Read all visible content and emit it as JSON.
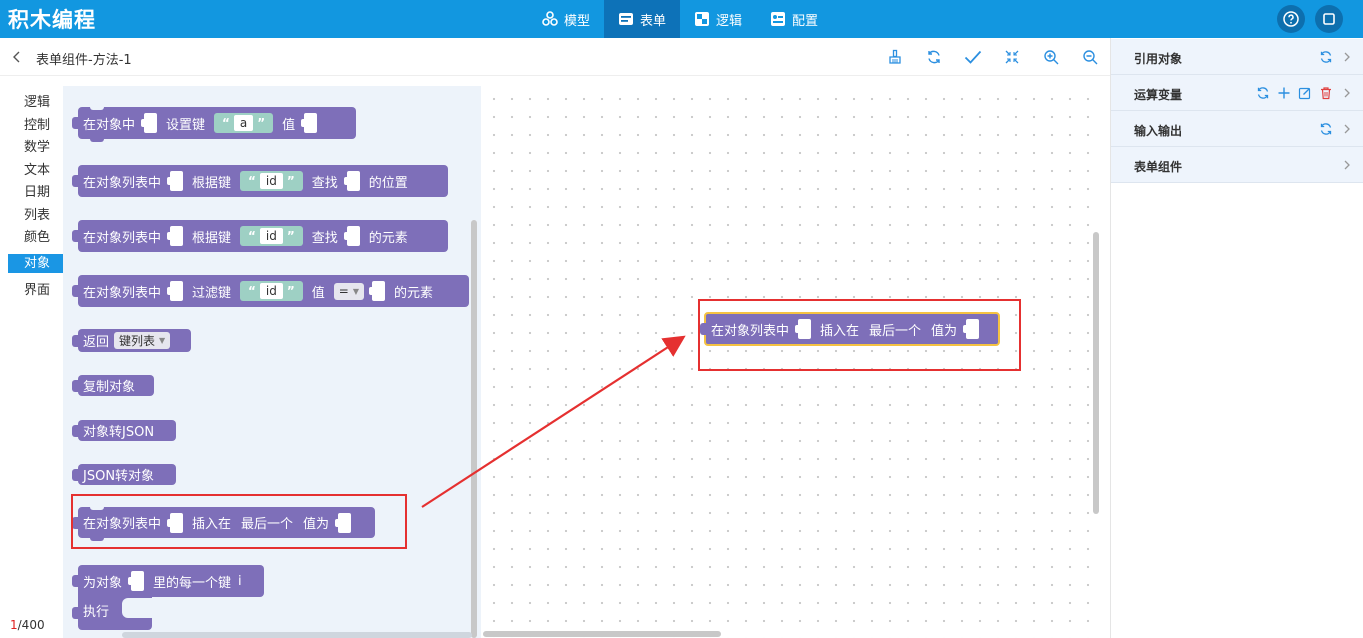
{
  "app": {
    "title": "积木编程"
  },
  "nav": [
    {
      "label": "模型",
      "icon": "model-icon"
    },
    {
      "label": "表单",
      "icon": "form-icon",
      "active": true
    },
    {
      "label": "逻辑",
      "icon": "logic-icon"
    },
    {
      "label": "配置",
      "icon": "config-icon"
    }
  ],
  "subheader": {
    "breadcrumb": "表单组件-方法-1"
  },
  "categories": [
    {
      "label": "逻辑"
    },
    {
      "label": "控制"
    },
    {
      "label": "数学"
    },
    {
      "label": "文本"
    },
    {
      "label": "日期"
    },
    {
      "label": "列表"
    },
    {
      "label": "颜色"
    },
    {
      "label": "对象",
      "active": true
    },
    {
      "label": "界面"
    }
  ],
  "page_count": {
    "current": "1",
    "total": "/400"
  },
  "blocks": {
    "b1": {
      "t1": "在对象中",
      "t2": "设置键",
      "key": "a",
      "t3": "值"
    },
    "b2": {
      "t1": "在对象列表中",
      "t2": "根据键",
      "key": "id",
      "t3": "查找",
      "t4": "的位置"
    },
    "b3": {
      "t1": "在对象列表中",
      "t2": "根据键",
      "key": "id",
      "t3": "查找",
      "t4": "的元素"
    },
    "b4": {
      "t1": "在对象列表中",
      "t2": "过滤键",
      "key": "id",
      "t3": "值",
      "op": "=",
      "t4": "的元素"
    },
    "b5": {
      "t1": "返回",
      "dd": "键列表"
    },
    "b6": {
      "t1": "复制对象"
    },
    "b7": {
      "t1": "对象转JSON"
    },
    "b8": {
      "t1": "JSON转对象"
    },
    "b9": {
      "t1": "在对象列表中",
      "t2": "插入在",
      "t3": "最后一个",
      "t4": "值为"
    },
    "b10": {
      "t1": "为对象",
      "t2": "里的每一个键",
      "var": "i",
      "t3": "执行"
    }
  },
  "workspace_block": {
    "t1": "在对象列表中",
    "t2": "插入在",
    "t3": "最后一个",
    "t4": "值为"
  },
  "quote_open": "“",
  "quote_close": "”",
  "right_panel": [
    {
      "label": "引用对象"
    },
    {
      "label": "运算变量"
    },
    {
      "label": "输入输出"
    },
    {
      "label": "表单组件"
    }
  ],
  "colors": {
    "topbar": "#1297e0",
    "block": "#7e6fb9",
    "highlight": "#e53030",
    "selected": "#f5c242"
  }
}
